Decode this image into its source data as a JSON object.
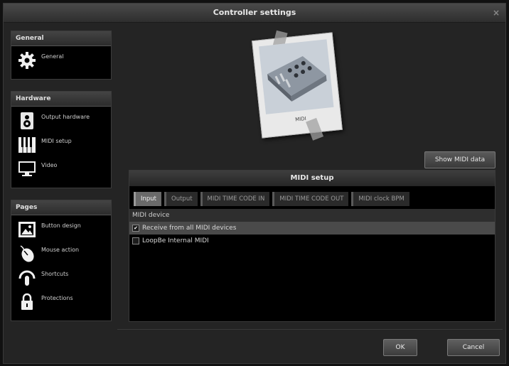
{
  "window": {
    "title": "Controller settings",
    "close_glyph": "×"
  },
  "sidebar": {
    "general": {
      "title": "General",
      "items": [
        {
          "label": "General",
          "icon": "gear-icon"
        }
      ]
    },
    "hardware": {
      "title": "Hardware",
      "items": [
        {
          "label": "Output hardware",
          "icon": "output-hardware-icon"
        },
        {
          "label": "MIDI setup",
          "icon": "piano-keys-icon"
        },
        {
          "label": "Video",
          "icon": "monitor-icon"
        }
      ]
    },
    "pages": {
      "title": "Pages",
      "items": [
        {
          "label": "Button design",
          "icon": "image-icon"
        },
        {
          "label": "Mouse action",
          "icon": "mouse-icon"
        },
        {
          "label": "Shortcuts",
          "icon": "touch-icon"
        },
        {
          "label": "Protections",
          "icon": "lock-icon"
        }
      ]
    }
  },
  "preview": {
    "caption": "MIDI"
  },
  "show_midi_data_label": "Show MIDI data",
  "midi_setup": {
    "title": "MIDI setup",
    "tabs": [
      {
        "label": "Input",
        "active": true
      },
      {
        "label": "Output",
        "active": false
      },
      {
        "label": "MIDI TIME CODE IN",
        "active": false
      },
      {
        "label": "MIDI TIME CODE OUT",
        "active": false
      },
      {
        "label": "MIDI clock BPM",
        "active": false
      }
    ],
    "column_header": "MIDI device",
    "devices": [
      {
        "label": "Receive from all MIDI devices",
        "checked": true,
        "selected": true
      },
      {
        "label": "LoopBe Internal MIDI",
        "checked": false,
        "selected": false
      }
    ]
  },
  "footer": {
    "ok_label": "OK",
    "cancel_label": "Cancel"
  },
  "colors": {
    "background": "#242424",
    "panel": "#000000",
    "accent_tab": "#6a6a6a"
  }
}
